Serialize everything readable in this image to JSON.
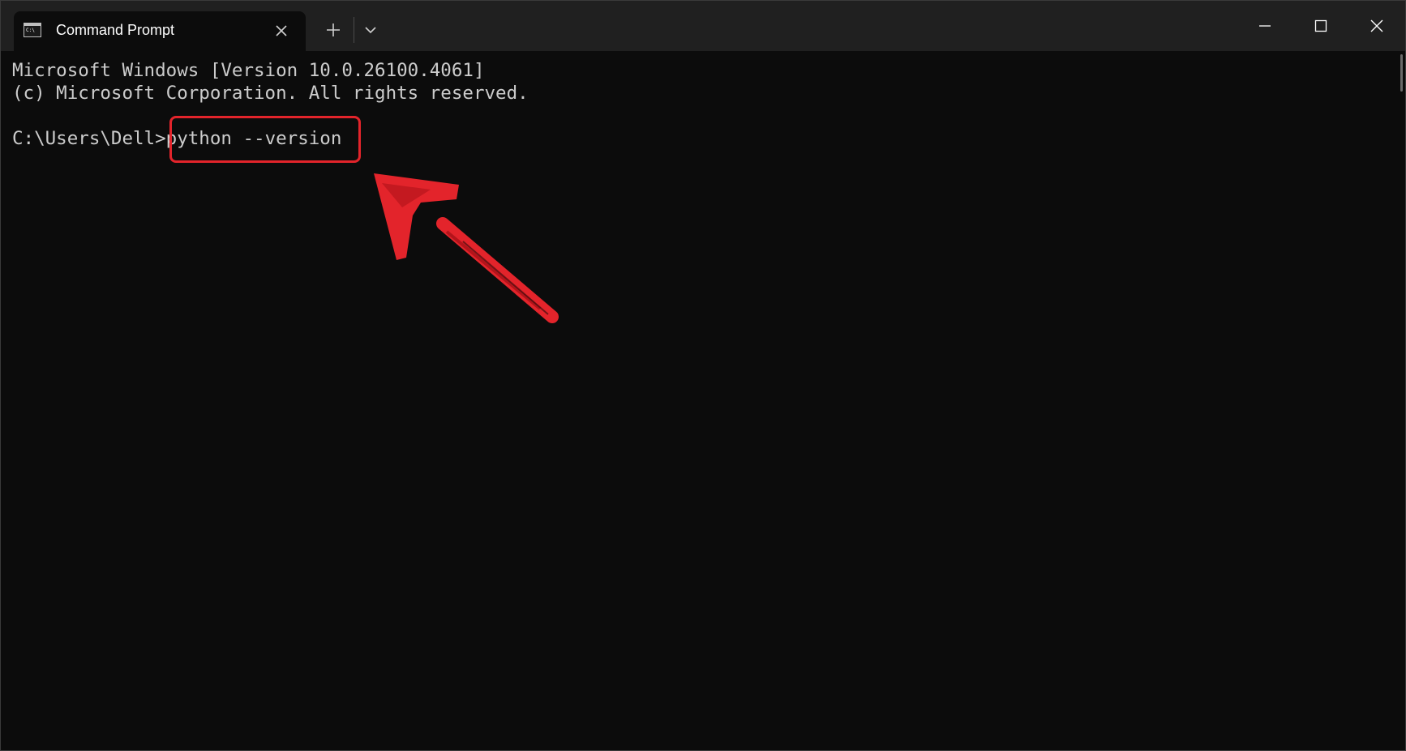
{
  "window": {
    "tab_title": "Command Prompt",
    "tab_icon": "terminal-icon",
    "new_tab_icon": "plus-icon",
    "dropdown_icon": "chevron-down-icon",
    "controls": [
      "minimize-icon",
      "maximize-icon",
      "close-icon"
    ]
  },
  "console": {
    "lines": [
      "Microsoft Windows [Version 10.0.26100.4061]",
      "(c) Microsoft Corporation. All rights reserved."
    ],
    "prompt": "C:\\Users\\Dell>",
    "command": "python --version"
  },
  "colors": {
    "background": "#0c0c0c",
    "titlebar": "#202020",
    "text": "#cccccc",
    "annotation": "#e3242b"
  }
}
